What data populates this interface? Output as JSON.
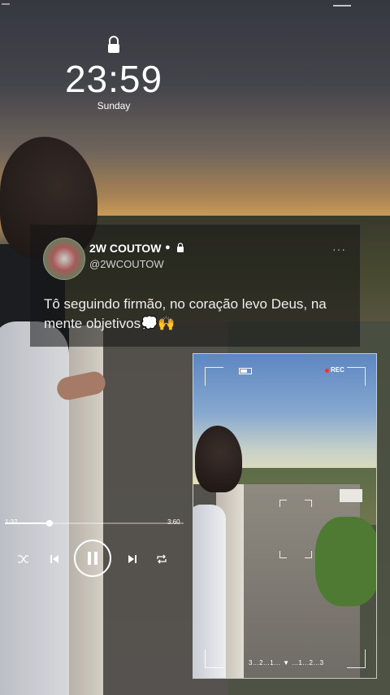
{
  "lock_screen": {
    "time": "23:59",
    "day": "Sunday"
  },
  "tweet": {
    "display_name": "2W COUTOW",
    "handle": "@2WCOUTOW",
    "text": "Tô seguindo firmão, no coração levo Deus, na mente objetivos💭🙌",
    "more_icon": "more-dots-icon"
  },
  "music_player": {
    "elapsed": "1:32",
    "duration": "3:60",
    "progress": 0.25,
    "controls": [
      "shuffle-icon",
      "previous-icon",
      "pause-icon",
      "next-icon",
      "repeat-icon"
    ]
  },
  "camera_overlay": {
    "rec_label": "REC",
    "counter": "3...2...1... ▼ ...1...2...3",
    "accent": "#ff2b2b"
  }
}
